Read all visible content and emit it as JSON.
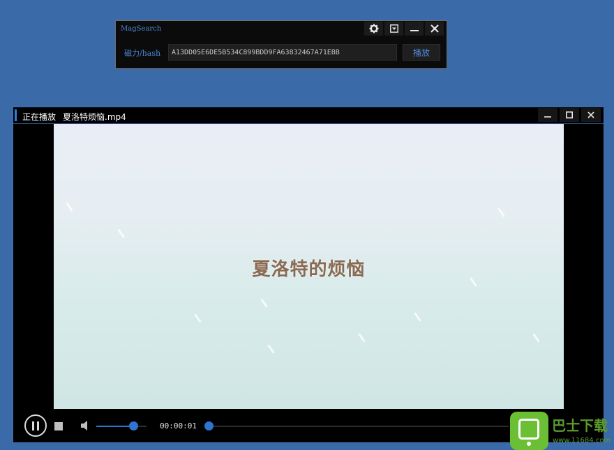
{
  "mag": {
    "title": "MagSearch",
    "label": "磁力/hash",
    "hash_value": "A13DD05E6DE5B534C899BDD9FA63832467A71EBB",
    "play_label": "播放",
    "icons": [
      "gear-icon",
      "dropdown-icon",
      "minimize-icon",
      "close-icon"
    ]
  },
  "player": {
    "status": "正在播放",
    "filename": "夏洛特烦恼.mp4",
    "video_caption": "夏洛特的烦恼",
    "time": "00:00:01",
    "volume_level": 0.75,
    "progress_level": 0.0,
    "icons": [
      "minimize-icon",
      "maximize-icon",
      "close-icon",
      "pause-icon",
      "stop-icon",
      "volume-icon"
    ]
  },
  "watermark": {
    "name": "巴士下载",
    "url": "www.11684.com"
  },
  "colors": {
    "desktop": "#3a6aa8",
    "accent": "#2f74d0",
    "label": "#4d86d8"
  }
}
